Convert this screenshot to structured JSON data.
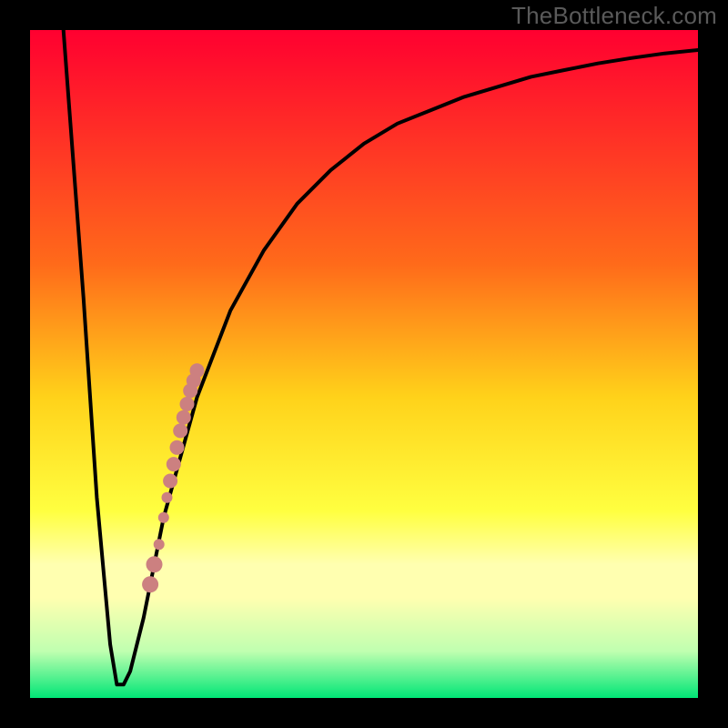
{
  "watermark": "TheBottleneck.com",
  "colors": {
    "frame": "#000000",
    "curve": "#000000",
    "dots": "#cc8080",
    "grad_top": "#ff0030",
    "grad_mid1": "#ff6a1a",
    "grad_mid2": "#ffd21a",
    "grad_mid3": "#ffff40",
    "grad_band": "#ffffb0",
    "grad_bottom1": "#c0ffb0",
    "grad_bottom2": "#00e676"
  },
  "chart_data": {
    "type": "line",
    "title": "",
    "xlabel": "",
    "ylabel": "",
    "xlim": [
      0,
      100
    ],
    "ylim": [
      0,
      100
    ],
    "series": [
      {
        "name": "bottleneck-curve",
        "x": [
          5,
          8,
          10,
          12,
          13,
          14,
          15,
          17,
          20,
          25,
          30,
          35,
          40,
          45,
          50,
          55,
          60,
          65,
          70,
          75,
          80,
          85,
          90,
          95,
          100
        ],
        "values": [
          100,
          60,
          30,
          8,
          2,
          2,
          4,
          12,
          27,
          45,
          58,
          67,
          74,
          79,
          83,
          86,
          88,
          90,
          91.5,
          93,
          94,
          95,
          95.8,
          96.5,
          97
        ]
      }
    ],
    "optimal_x_range": [
      12,
      14
    ],
    "dots": {
      "name": "highlighted-region",
      "x": [
        18.0,
        18.6,
        19.3,
        20.0,
        20.5,
        21.0,
        21.5,
        22.0,
        22.5,
        23.0,
        23.5,
        24.0,
        24.5,
        25.0
      ],
      "values": [
        17.0,
        20.0,
        23.0,
        27.0,
        30.0,
        32.5,
        35.0,
        37.5,
        40.0,
        42.0,
        44.0,
        46.0,
        47.5,
        49.0
      ],
      "radius_px": [
        9,
        9,
        6,
        6,
        6,
        8,
        8,
        8,
        8,
        8,
        8,
        8,
        8,
        8
      ]
    },
    "background": "vertical rainbow gradient: red (top) → orange → yellow → pale yellow band → green (bottom)"
  }
}
